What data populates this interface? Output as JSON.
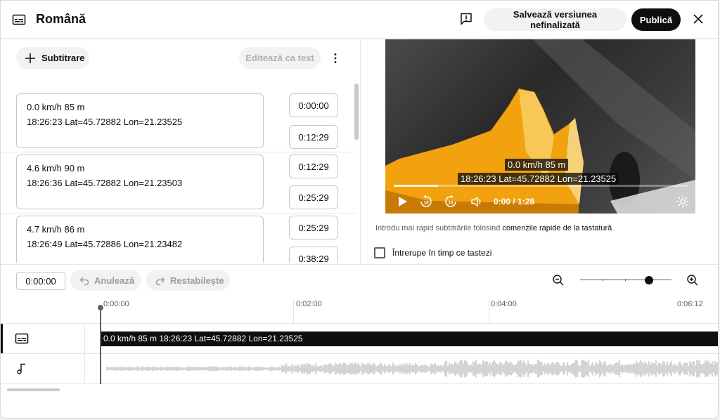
{
  "header": {
    "title": "Română",
    "save_draft_label": "Salvează versiunea nefinalizată",
    "publish_label": "Publică"
  },
  "left_panel": {
    "add_subtitle_label": "Subtitrare",
    "edit_as_text_label": "Editează ca text",
    "cues": [
      {
        "line1": "0.0 km/h   85 m",
        "line2": "18:26:23 Lat=45.72882 Lon=21.23525",
        "start": "0:00:00",
        "end": "0:12:29"
      },
      {
        "line1": "4.6 km/h   90 m",
        "line2": "18:26:36 Lat=45.72882 Lon=21.23503",
        "start": "0:12:29",
        "end": "0:25:29"
      },
      {
        "line1": "4.7 km/h   86 m",
        "line2": "18:26:49 Lat=45.72886 Lon=21.23482",
        "start": "0:25:29",
        "end": "0:38:29"
      }
    ]
  },
  "video": {
    "overlay_line1": "0.0 km/h   85 m",
    "overlay_line2": "18:26:23 Lat=45.72882 Lon=21.23525",
    "time_display": "0:00 / 1:28",
    "progress": 0.15
  },
  "hint": {
    "text": "Introdu mai rapid subtitrările folosind ",
    "link": "comenzile rapide de la tastatură",
    "suffix": "."
  },
  "pause_while_typing_label": "Întrerupe în timp ce tastezi",
  "timeline": {
    "current_time": "0:00:00",
    "undo_label": "Anulează",
    "redo_label": "Restabilește",
    "zoom_level": 0.75,
    "ticks": [
      "0:00:00",
      "0:02:00",
      "0:04:00",
      "0:06:12"
    ],
    "subtitle_block_text": "0.0 km/h 85 m 18:26:23 Lat=45.72882 Lon=21.23525"
  },
  "icons": {
    "header": "subtitles-icon",
    "feedback": "feedback-icon",
    "close": "close-icon",
    "more": "more-vert-icon",
    "play": "play-icon",
    "rewind": "rewind-10-icon",
    "forward": "forward-10-icon",
    "volume": "volume-icon",
    "settings": "gear-icon",
    "music": "music-note-icon"
  }
}
